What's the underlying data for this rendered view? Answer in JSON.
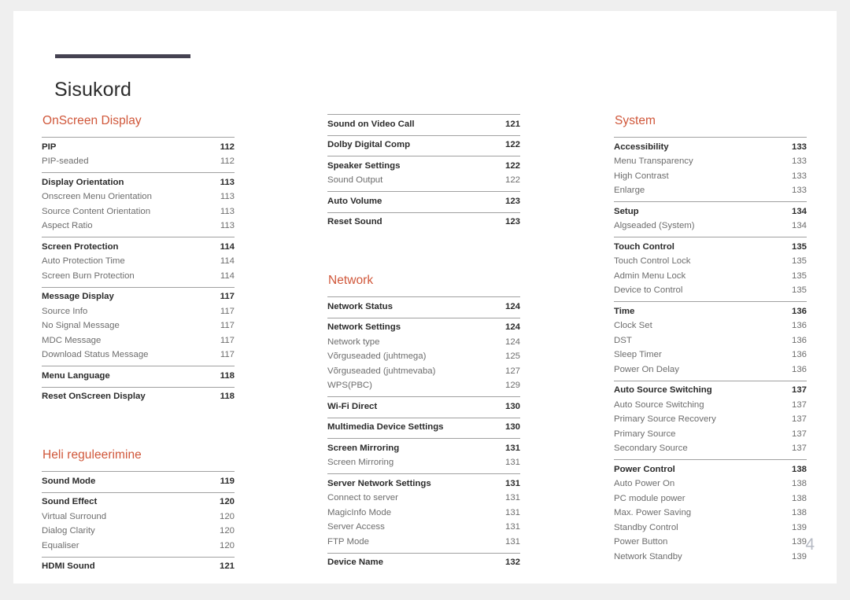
{
  "document": {
    "title": "Sisukord",
    "page_number": "4",
    "accent_color": "#d0573a",
    "rule_color": "#454251",
    "divider_color": "#a0a0a0",
    "page_number_color": "#b6bac4"
  },
  "columns": [
    {
      "id": "column-1",
      "sections": [
        {
          "heading": "OnScreen Display",
          "groups": [
            {
              "entries": [
                {
                  "label": "PIP",
                  "page": "112",
                  "level": 1
                },
                {
                  "label": "PIP-seaded",
                  "page": "112",
                  "level": 2
                }
              ]
            },
            {
              "entries": [
                {
                  "label": "Display Orientation",
                  "page": "113",
                  "level": 1
                },
                {
                  "label": "Onscreen Menu Orientation",
                  "page": "113",
                  "level": 2
                },
                {
                  "label": "Source Content Orientation",
                  "page": "113",
                  "level": 2
                },
                {
                  "label": "Aspect Ratio",
                  "page": "113",
                  "level": 2
                }
              ]
            },
            {
              "entries": [
                {
                  "label": "Screen Protection",
                  "page": "114",
                  "level": 1
                },
                {
                  "label": "Auto Protection Time",
                  "page": "114",
                  "level": 2
                },
                {
                  "label": "Screen Burn Protection",
                  "page": "114",
                  "level": 2
                }
              ]
            },
            {
              "entries": [
                {
                  "label": "Message Display",
                  "page": "117",
                  "level": 1
                },
                {
                  "label": "Source Info",
                  "page": "117",
                  "level": 2
                },
                {
                  "label": "No Signal Message",
                  "page": "117",
                  "level": 2
                },
                {
                  "label": "MDC Message",
                  "page": "117",
                  "level": 2
                },
                {
                  "label": "Download Status Message",
                  "page": "117",
                  "level": 2
                }
              ]
            },
            {
              "entries": [
                {
                  "label": "Menu Language",
                  "page": "118",
                  "level": 1
                }
              ]
            },
            {
              "entries": [
                {
                  "label": "Reset OnScreen Display",
                  "page": "118",
                  "level": 1
                }
              ]
            }
          ]
        },
        {
          "heading": "Heli reguleerimine",
          "groups": [
            {
              "entries": [
                {
                  "label": "Sound Mode",
                  "page": "119",
                  "level": 1
                }
              ]
            },
            {
              "entries": [
                {
                  "label": "Sound Effect",
                  "page": "120",
                  "level": 1
                },
                {
                  "label": "Virtual Surround",
                  "page": "120",
                  "level": 2
                },
                {
                  "label": "Dialog Clarity",
                  "page": "120",
                  "level": 2
                },
                {
                  "label": "Equaliser",
                  "page": "120",
                  "level": 2
                }
              ]
            },
            {
              "entries": [
                {
                  "label": "HDMI Sound",
                  "page": "121",
                  "level": 1
                }
              ]
            }
          ]
        }
      ]
    },
    {
      "id": "column-2",
      "sections": [
        {
          "heading": "",
          "groups": [
            {
              "entries": [
                {
                  "label": "Sound on Video Call",
                  "page": "121",
                  "level": 1
                }
              ]
            },
            {
              "entries": [
                {
                  "label": "Dolby Digital Comp",
                  "page": "122",
                  "level": 1
                }
              ]
            },
            {
              "entries": [
                {
                  "label": "Speaker Settings",
                  "page": "122",
                  "level": 1
                },
                {
                  "label": "Sound Output",
                  "page": "122",
                  "level": 2
                }
              ]
            },
            {
              "entries": [
                {
                  "label": "Auto Volume",
                  "page": "123",
                  "level": 1
                }
              ]
            },
            {
              "entries": [
                {
                  "label": "Reset Sound",
                  "page": "123",
                  "level": 1
                }
              ]
            }
          ]
        },
        {
          "heading": "Network",
          "groups": [
            {
              "entries": [
                {
                  "label": "Network Status",
                  "page": "124",
                  "level": 1
                }
              ]
            },
            {
              "entries": [
                {
                  "label": "Network Settings",
                  "page": "124",
                  "level": 1
                },
                {
                  "label": "Network type",
                  "page": "124",
                  "level": 2
                },
                {
                  "label": "Võrguseaded (juhtmega)",
                  "page": "125",
                  "level": 2
                },
                {
                  "label": "Võrguseaded (juhtmevaba)",
                  "page": "127",
                  "level": 2
                },
                {
                  "label": "WPS(PBC)",
                  "page": "129",
                  "level": 2
                }
              ]
            },
            {
              "entries": [
                {
                  "label": "Wi-Fi Direct",
                  "page": "130",
                  "level": 1
                }
              ]
            },
            {
              "entries": [
                {
                  "label": "Multimedia Device Settings",
                  "page": "130",
                  "level": 1
                }
              ]
            },
            {
              "entries": [
                {
                  "label": "Screen Mirroring",
                  "page": "131",
                  "level": 1
                },
                {
                  "label": "Screen Mirroring",
                  "page": "131",
                  "level": 2
                }
              ]
            },
            {
              "entries": [
                {
                  "label": "Server Network Settings",
                  "page": "131",
                  "level": 1
                },
                {
                  "label": "Connect to server",
                  "page": "131",
                  "level": 2
                },
                {
                  "label": "MagicInfo Mode",
                  "page": "131",
                  "level": 2
                },
                {
                  "label": "Server Access",
                  "page": "131",
                  "level": 2
                },
                {
                  "label": "FTP Mode",
                  "page": "131",
                  "level": 2
                }
              ]
            },
            {
              "entries": [
                {
                  "label": "Device Name",
                  "page": "132",
                  "level": 1
                }
              ]
            }
          ]
        }
      ]
    },
    {
      "id": "column-3",
      "sections": [
        {
          "heading": "System",
          "groups": [
            {
              "entries": [
                {
                  "label": "Accessibility",
                  "page": "133",
                  "level": 1
                },
                {
                  "label": "Menu Transparency",
                  "page": "133",
                  "level": 2
                },
                {
                  "label": "High Contrast",
                  "page": "133",
                  "level": 2
                },
                {
                  "label": "Enlarge",
                  "page": "133",
                  "level": 2
                }
              ]
            },
            {
              "entries": [
                {
                  "label": "Setup",
                  "page": "134",
                  "level": 1
                },
                {
                  "label": "Algseaded (System)",
                  "page": "134",
                  "level": 2
                }
              ]
            },
            {
              "entries": [
                {
                  "label": "Touch Control",
                  "page": "135",
                  "level": 1
                },
                {
                  "label": "Touch Control Lock",
                  "page": "135",
                  "level": 2
                },
                {
                  "label": "Admin Menu Lock",
                  "page": "135",
                  "level": 2
                },
                {
                  "label": "Device to Control",
                  "page": "135",
                  "level": 2
                }
              ]
            },
            {
              "entries": [
                {
                  "label": "Time",
                  "page": "136",
                  "level": 1
                },
                {
                  "label": "Clock Set",
                  "page": "136",
                  "level": 2
                },
                {
                  "label": "DST",
                  "page": "136",
                  "level": 2
                },
                {
                  "label": "Sleep Timer",
                  "page": "136",
                  "level": 2
                },
                {
                  "label": "Power On Delay",
                  "page": "136",
                  "level": 2
                }
              ]
            },
            {
              "entries": [
                {
                  "label": "Auto Source Switching",
                  "page": "137",
                  "level": 1
                },
                {
                  "label": "Auto Source Switching",
                  "page": "137",
                  "level": 2
                },
                {
                  "label": "Primary Source Recovery",
                  "page": "137",
                  "level": 2
                },
                {
                  "label": "Primary Source",
                  "page": "137",
                  "level": 2
                },
                {
                  "label": "Secondary Source",
                  "page": "137",
                  "level": 2
                }
              ]
            },
            {
              "entries": [
                {
                  "label": "Power Control",
                  "page": "138",
                  "level": 1
                },
                {
                  "label": "Auto Power On",
                  "page": "138",
                  "level": 2
                },
                {
                  "label": "PC module power",
                  "page": "138",
                  "level": 2
                },
                {
                  "label": "Max. Power Saving",
                  "page": "138",
                  "level": 2
                },
                {
                  "label": "Standby Control",
                  "page": "139",
                  "level": 2
                },
                {
                  "label": "Power Button",
                  "page": "139",
                  "level": 2
                },
                {
                  "label": "Network Standby",
                  "page": "139",
                  "level": 2
                }
              ]
            }
          ]
        }
      ]
    }
  ]
}
